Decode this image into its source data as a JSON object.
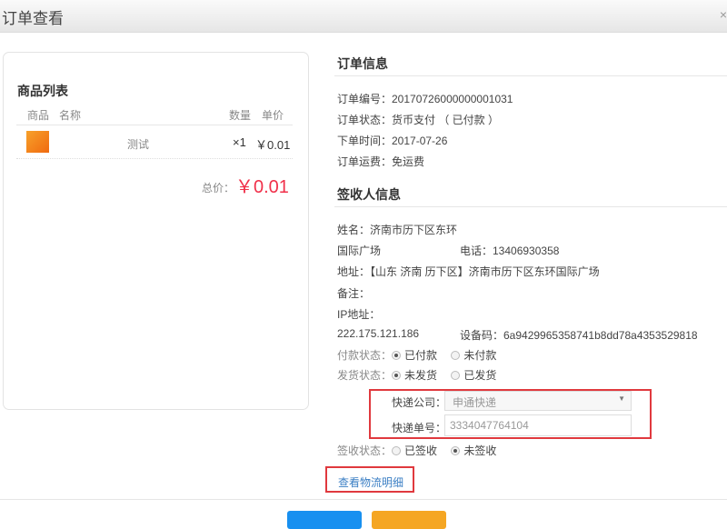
{
  "dialog": {
    "title": "订单查看",
    "close": "×"
  },
  "goods": {
    "title": "商品列表",
    "columns": [
      "商品",
      "名称",
      "数量",
      "单价"
    ],
    "items": [
      {
        "name": "测试",
        "qty": "×1",
        "price": "￥0.01"
      }
    ],
    "total_label": "总价：",
    "total_value": "￥0.01"
  },
  "order": {
    "title": "订单信息",
    "rows": [
      "订单编号：20170726000000001031",
      "订单状态：货币支付 （ 已付款 ）",
      "下单时间：2017-07-26",
      "订单运费：免运费"
    ]
  },
  "receiver": {
    "title": "签收人信息",
    "name": "姓名：济南市历下区东环",
    "name_cont": "国际广场",
    "phone": "电话：13406930358",
    "address": "地址：【山东 济南 历下区】济南市历下区东环国际广场",
    "remark": "备注：",
    "ip_label": "IP地址：",
    "ip": "222.175.121.186",
    "device": "设备码：6a9429965358741b8dd78a4353529818"
  },
  "payment": {
    "label": "付款状态：",
    "options": [
      "已付款",
      "未付款"
    ],
    "selected": "已付款"
  },
  "shipping": {
    "label": "发货状态：",
    "options": [
      "未发货",
      "已发货"
    ],
    "selected": "未发货"
  },
  "express": {
    "company_label": "快递公司：",
    "company_value": "申通快递",
    "number_label": "快递单号：",
    "number_value": "3334047764104"
  },
  "sign": {
    "label": "签收状态：",
    "options": [
      "已签收",
      "未签收"
    ],
    "selected": "未签收"
  },
  "logistics_link": "查看物流明细",
  "colors": {
    "price": "#f0304a",
    "link": "#3b7fc4",
    "highlight": "#e0393e",
    "primary": "#1890f0",
    "warning": "#f5a623"
  }
}
